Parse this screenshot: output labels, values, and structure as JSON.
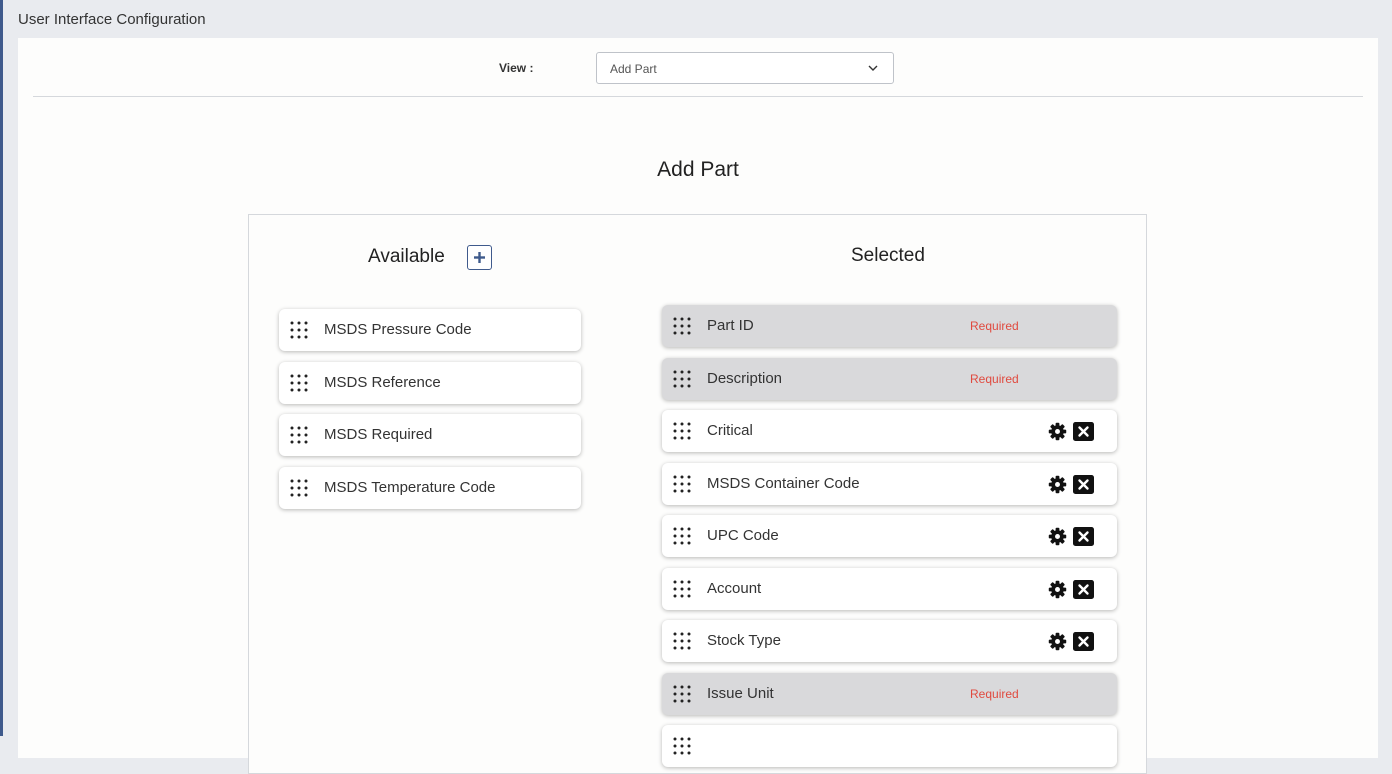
{
  "app": {
    "title": "User Interface Configuration"
  },
  "view": {
    "label": "View :",
    "selected": "Add Part"
  },
  "page": {
    "title": "Add Part"
  },
  "available": {
    "title": "Available",
    "items": [
      {
        "label": "MSDS Pressure Code"
      },
      {
        "label": "MSDS Reference"
      },
      {
        "label": "MSDS Required"
      },
      {
        "label": "MSDS Temperature Code"
      }
    ]
  },
  "selected": {
    "title": "Selected",
    "items": [
      {
        "label": "Part ID",
        "required": true,
        "required_label": "Required"
      },
      {
        "label": "Description",
        "required": true,
        "required_label": "Required"
      },
      {
        "label": "Critical",
        "required": false
      },
      {
        "label": "MSDS Container Code",
        "required": false
      },
      {
        "label": "UPC Code",
        "required": false
      },
      {
        "label": "Account",
        "required": false
      },
      {
        "label": "Stock Type",
        "required": false
      },
      {
        "label": "Issue Unit",
        "required": true,
        "required_label": "Required"
      },
      {
        "label": "",
        "required": false
      }
    ]
  },
  "colors": {
    "accent": "#3f5a8c",
    "required_text": "#e04a3f",
    "required_bg": "#d9d9db"
  },
  "icons": {
    "drag": "drag-handle-icon",
    "gear": "gear-icon",
    "close": "close-box-icon",
    "add": "plus-icon",
    "chevron": "chevron-down-icon"
  }
}
